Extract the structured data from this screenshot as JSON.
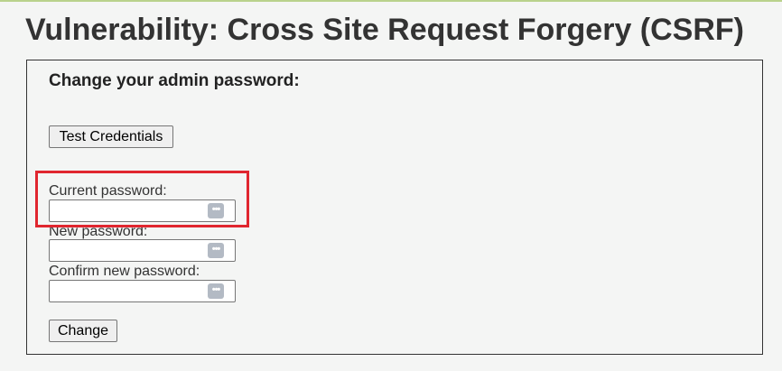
{
  "page": {
    "title": "Vulnerability: Cross Site Request Forgery (CSRF)"
  },
  "form": {
    "heading": "Change your admin password:",
    "test_button_label": "Test Credentials",
    "current_password_label": "Current password:",
    "new_password_label": "New password:",
    "confirm_password_label": "Confirm new password:",
    "current_password_value": "",
    "new_password_value": "",
    "confirm_password_value": "",
    "change_button_label": "Change",
    "password_manager_icon": "password-manager-icon",
    "password_manager_glyph": "•••"
  },
  "annotation": {
    "highlight_color": "#e0262f"
  }
}
